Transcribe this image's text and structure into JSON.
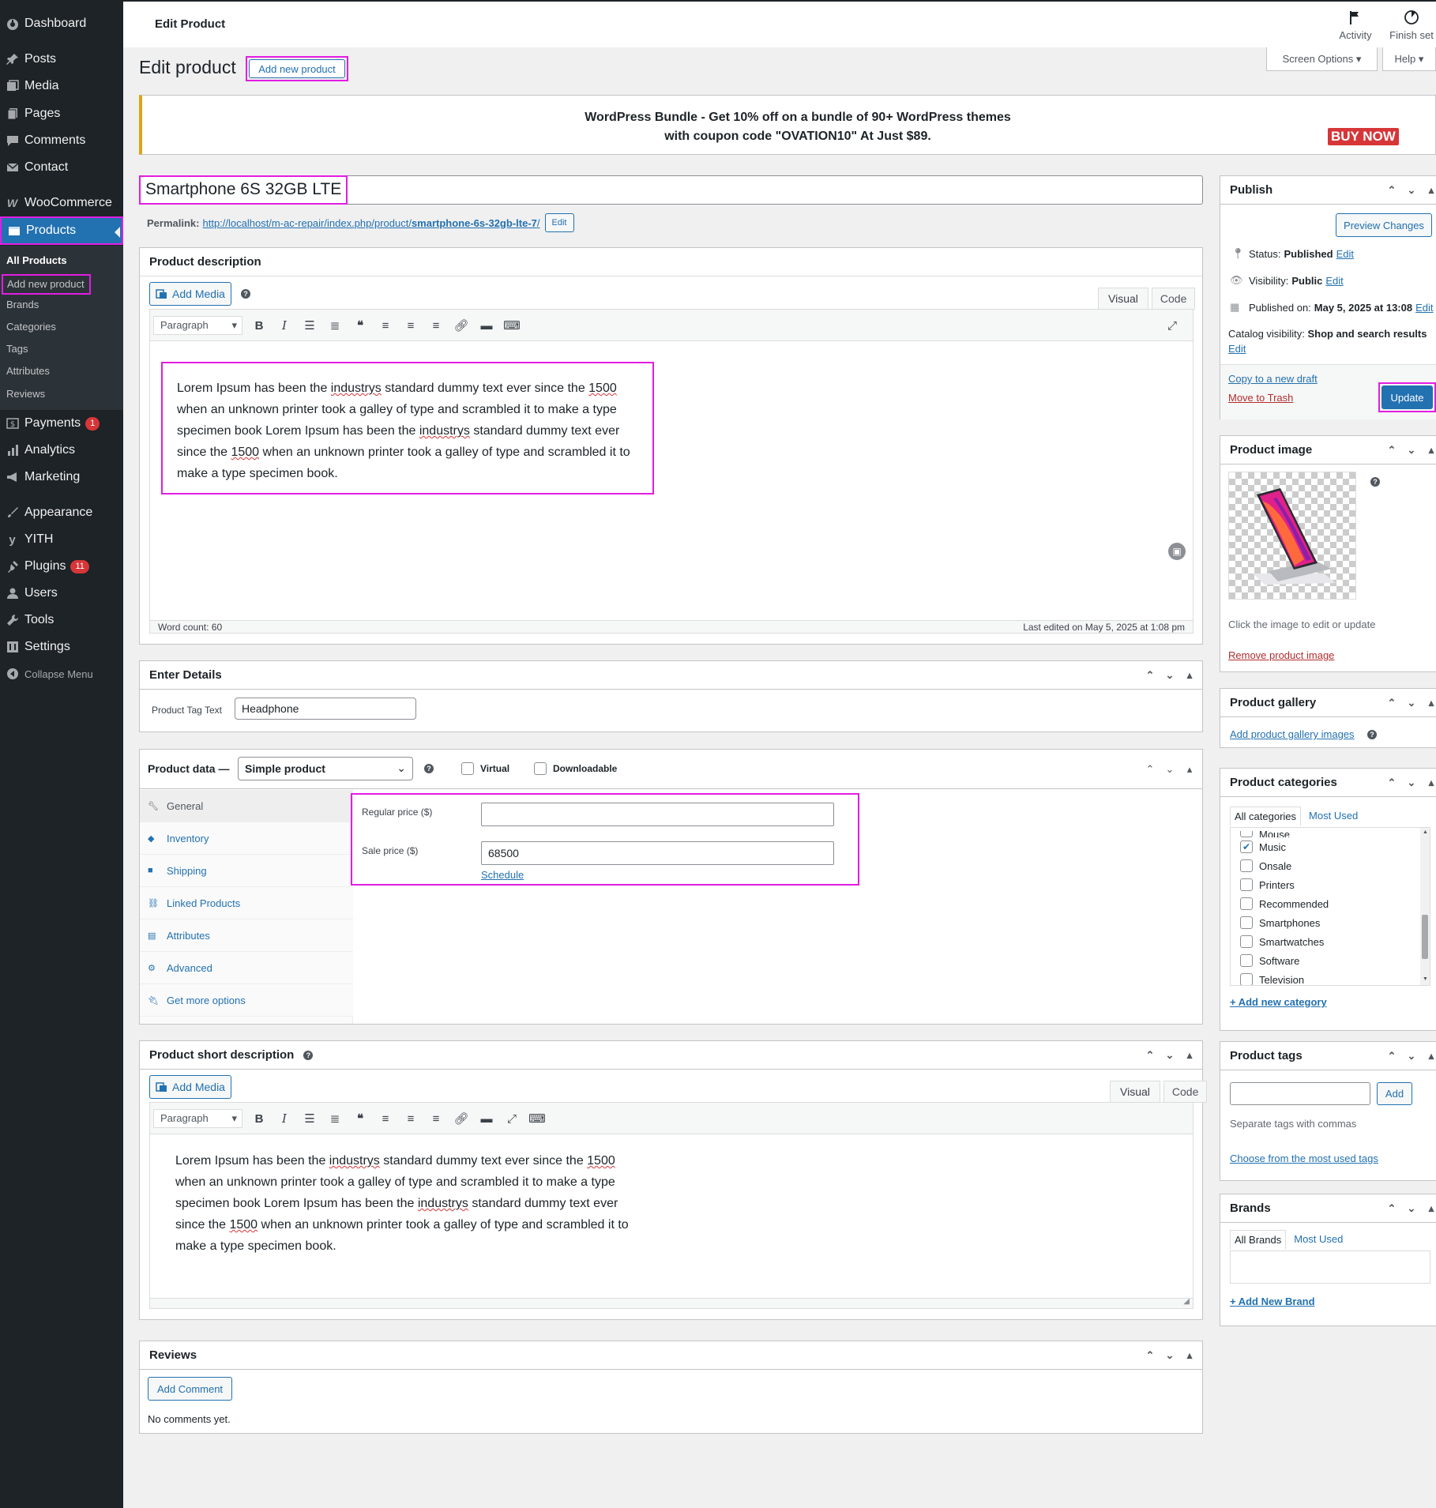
{
  "sidebar": {
    "items": [
      {
        "icon": "dashboard-icon",
        "label": "Dashboard"
      },
      {
        "icon": "pin-icon",
        "label": "Posts"
      },
      {
        "icon": "media-icon",
        "label": "Media"
      },
      {
        "icon": "pages-icon",
        "label": "Pages"
      },
      {
        "icon": "comment-icon",
        "label": "Comments"
      },
      {
        "icon": "mail-icon",
        "label": "Contact"
      },
      {
        "icon": "woocommerce-icon",
        "label": "WooCommerce"
      },
      {
        "icon": "products-icon",
        "label": "Products"
      },
      {
        "icon": "payments-icon",
        "label": "Payments",
        "badge": "1"
      },
      {
        "icon": "analytics-icon",
        "label": "Analytics"
      },
      {
        "icon": "megaphone-icon",
        "label": "Marketing"
      },
      {
        "icon": "brush-icon",
        "label": "Appearance"
      },
      {
        "icon": "yith-icon",
        "label": "YITH"
      },
      {
        "icon": "plugin-icon",
        "label": "Plugins",
        "badge": "11"
      },
      {
        "icon": "users-icon",
        "label": "Users"
      },
      {
        "icon": "tools-icon",
        "label": "Tools"
      },
      {
        "icon": "settings-icon",
        "label": "Settings"
      },
      {
        "icon": "collapse-icon",
        "label": "Collapse Menu"
      }
    ],
    "submenu": [
      "All Products",
      "Add new product",
      "Brands",
      "Categories",
      "Tags",
      "Attributes",
      "Reviews"
    ]
  },
  "topbar": {
    "title": "Edit Product",
    "activity": "Activity",
    "finish": "Finish set"
  },
  "screen_options": "Screen Options",
  "help": "Help",
  "page_title": "Edit product",
  "add_new": "Add new product",
  "banner": {
    "line1": "WordPress Bundle - Get 10% off on a bundle of 90+ WordPress themes",
    "line2": "with coupon code \"OVATION10\" At Just $89.",
    "cta": "BUY NOW"
  },
  "product_title": "Smartphone 6S 32GB LTE",
  "permalink": {
    "label": "Permalink:",
    "base": "http://localhost/m-ac-repair/index.php/product/",
    "slug": "smartphone-6s-32gb-lte-7",
    "trail": "/",
    "edit": "Edit"
  },
  "description": {
    "heading": "Product description",
    "add_media": "Add Media",
    "tab_visual": "Visual",
    "tab_code": "Code",
    "format": "Paragraph",
    "text_parts": [
      "Lorem Ipsum has been the ",
      "industrys",
      " standard dummy text ever since the ",
      "1500",
      " when an unknown printer took a galley of type and scrambled it to make a type specimen book Lorem Ipsum has been the ",
      "industrys",
      " standard dummy text ever since the ",
      "1500",
      " when an unknown printer took a galley of type and scrambled it to make a type specimen book."
    ],
    "word_count": "Word count: 60",
    "last_edited": "Last edited on May 5, 2025 at 1:08 pm"
  },
  "details": {
    "heading": "Enter Details",
    "label": "Product Tag Text",
    "value": "Headphone"
  },
  "product_data": {
    "heading": "Product data —",
    "type": "Simple product",
    "virtual": "Virtual",
    "downloadable": "Downloadable",
    "tabs": [
      "General",
      "Inventory",
      "Shipping",
      "Linked Products",
      "Attributes",
      "Advanced",
      "Get more options"
    ],
    "regular_label": "Regular price ($)",
    "regular_value": "",
    "sale_label": "Sale price ($)",
    "sale_value": "68500",
    "schedule": "Schedule"
  },
  "short_description": {
    "heading": "Product short description",
    "add_media": "Add Media",
    "tab_visual": "Visual",
    "tab_code": "Code",
    "format": "Paragraph"
  },
  "reviews": {
    "heading": "Reviews",
    "add": "Add Comment",
    "empty": "No comments yet."
  },
  "publish": {
    "heading": "Publish",
    "preview": "Preview Changes",
    "status_label": "Status:",
    "status_value": "Published",
    "visibility_label": "Visibility:",
    "visibility_value": "Public",
    "published_label": "Published on:",
    "published_value": "May 5, 2025 at 13:08",
    "catalog_label": "Catalog visibility:",
    "catalog_value": "Shop and search results",
    "edit": "Edit",
    "copy": "Copy to a new draft",
    "trash": "Move to Trash",
    "update": "Update"
  },
  "product_image": {
    "heading": "Product image",
    "hint": "Click the image to edit or update",
    "remove": "Remove product image"
  },
  "gallery": {
    "heading": "Product gallery",
    "add": "Add product gallery images"
  },
  "categories": {
    "heading": "Product categories",
    "tab_all": "All categories",
    "tab_most": "Most Used",
    "partial": "Mouse",
    "items": [
      {
        "name": "Music",
        "checked": true
      },
      {
        "name": "Onsale",
        "checked": false
      },
      {
        "name": "Printers",
        "checked": false
      },
      {
        "name": "Recommended",
        "checked": false
      },
      {
        "name": "Smartphones",
        "checked": false
      },
      {
        "name": "Smartwatches",
        "checked": false
      },
      {
        "name": "Software",
        "checked": false
      },
      {
        "name": "Television",
        "checked": false
      }
    ],
    "add": "+ Add new category"
  },
  "tags": {
    "heading": "Product tags",
    "add": "Add",
    "hint": "Separate tags with commas",
    "choose": "Choose from the most used tags"
  },
  "brands": {
    "heading": "Brands",
    "tab_all": "All Brands",
    "tab_most": "Most Used",
    "add": "+ Add New Brand"
  },
  "colors": {
    "accent": "#2271b1",
    "highlight": "#e21de2",
    "sidebar": "#1d2327",
    "banner_border": "#dba617",
    "buy_now": "#d63638"
  }
}
